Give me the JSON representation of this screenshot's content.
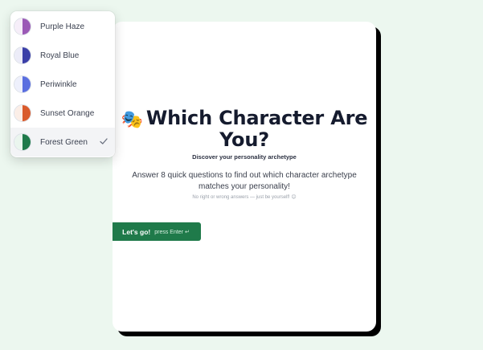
{
  "quiz": {
    "title_emoji": "🎭",
    "title": "Which Character Are You?",
    "subtitle": "Discover your personality archetype",
    "intro": "Answer 8 quick questions to find out which character archetype matches your personality!",
    "note": "No right or wrong answers — just be yourself! 😊",
    "start_label": "Let's go!",
    "start_hint": "press Enter ↵"
  },
  "theme_menu": {
    "selected": "Forest Green",
    "items": [
      {
        "label": "Purple Haze",
        "light": "#f6eef9",
        "dark": "#9b59b6"
      },
      {
        "label": "Royal Blue",
        "light": "#ececf8",
        "dark": "#3b3fa8"
      },
      {
        "label": "Periwinkle",
        "light": "#eef0fc",
        "dark": "#5a6ee0"
      },
      {
        "label": "Sunset Orange",
        "light": "#fbeee7",
        "dark": "#d95a2b"
      },
      {
        "label": "Forest Green",
        "light": "#eaf5ee",
        "dark": "#1f7a4a"
      }
    ]
  },
  "colors": {
    "accent": "#1f7a4a",
    "background": "#ecf7ef"
  }
}
